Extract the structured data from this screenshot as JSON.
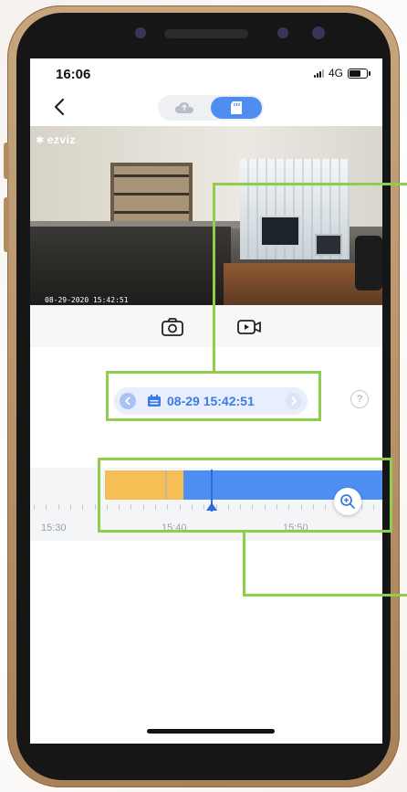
{
  "status_bar": {
    "time": "16:06",
    "network": "4G"
  },
  "nav": {
    "back_icon": "chevron-left-icon",
    "source_toggle": {
      "cloud_icon": "cloud-icon",
      "sd_card_icon": "sd-card-icon",
      "selected": "sd-card"
    }
  },
  "video": {
    "brand": "ezviz",
    "timestamp": "08-29-2020 15:42:51"
  },
  "controls": {
    "snapshot_icon": "camera-icon",
    "record_icon": "video-record-icon"
  },
  "playback": {
    "date_display": "08-29 15:42:51",
    "prev_icon": "chevron-left-icon",
    "next_icon": "chevron-right-icon",
    "calendar_icon": "calendar-icon",
    "help_label": "?"
  },
  "timeline": {
    "tick_labels": [
      "15:30",
      "15:40",
      "15:50"
    ],
    "zoom_icon": "zoom-in-icon",
    "segments": [
      {
        "type": "event",
        "color": "#f6bf56"
      },
      {
        "type": "continuous",
        "color": "#4f8ef2"
      }
    ]
  },
  "colors": {
    "accent": "#4f8df0",
    "highlight": "#8fce4c",
    "event": "#f6bf56"
  }
}
